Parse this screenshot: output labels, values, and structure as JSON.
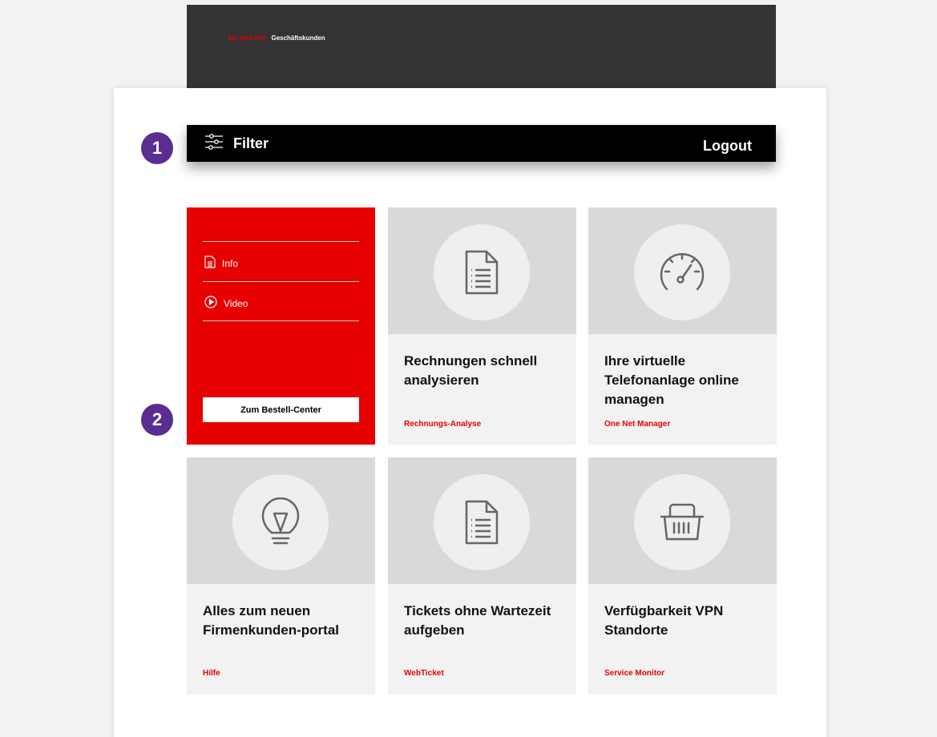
{
  "breadcrumb": {
    "prefix": "Sie sind hier:",
    "current": "Geschäftskunden"
  },
  "toolbar": {
    "filter_label": "Filter",
    "logout_label": "Logout"
  },
  "badges": [
    "1",
    "2"
  ],
  "red_card": {
    "links": [
      {
        "icon": "document-icon",
        "label": "Info"
      },
      {
        "icon": "play-circle-icon",
        "label": "Video"
      }
    ],
    "button_label": "Zum Bestell-Center"
  },
  "cards": [
    {
      "icon": "invoice-icon",
      "title": "Rechnungen schnell analysieren",
      "subtitle": "Rechnungs-Analyse"
    },
    {
      "icon": "speedometer-icon",
      "title": "Ihre virtuelle Telefonanlage online managen",
      "subtitle": "One Net Manager"
    },
    {
      "icon": "lightbulb-icon",
      "title": "Alles zum neuen Firmenkunden-portal",
      "subtitle": "Hilfe"
    },
    {
      "icon": "ticket-document-icon",
      "title": "Tickets ohne Wartezeit aufgeben",
      "subtitle": "WebTicket"
    },
    {
      "icon": "shopping-basket-icon",
      "title": "Verfügbarkeit VPN Standorte",
      "subtitle": "Service Monitor"
    }
  ],
  "colors": {
    "brand_red": "#e60000",
    "dark_bar": "#333333",
    "badge_purple": "#5a2d91"
  }
}
